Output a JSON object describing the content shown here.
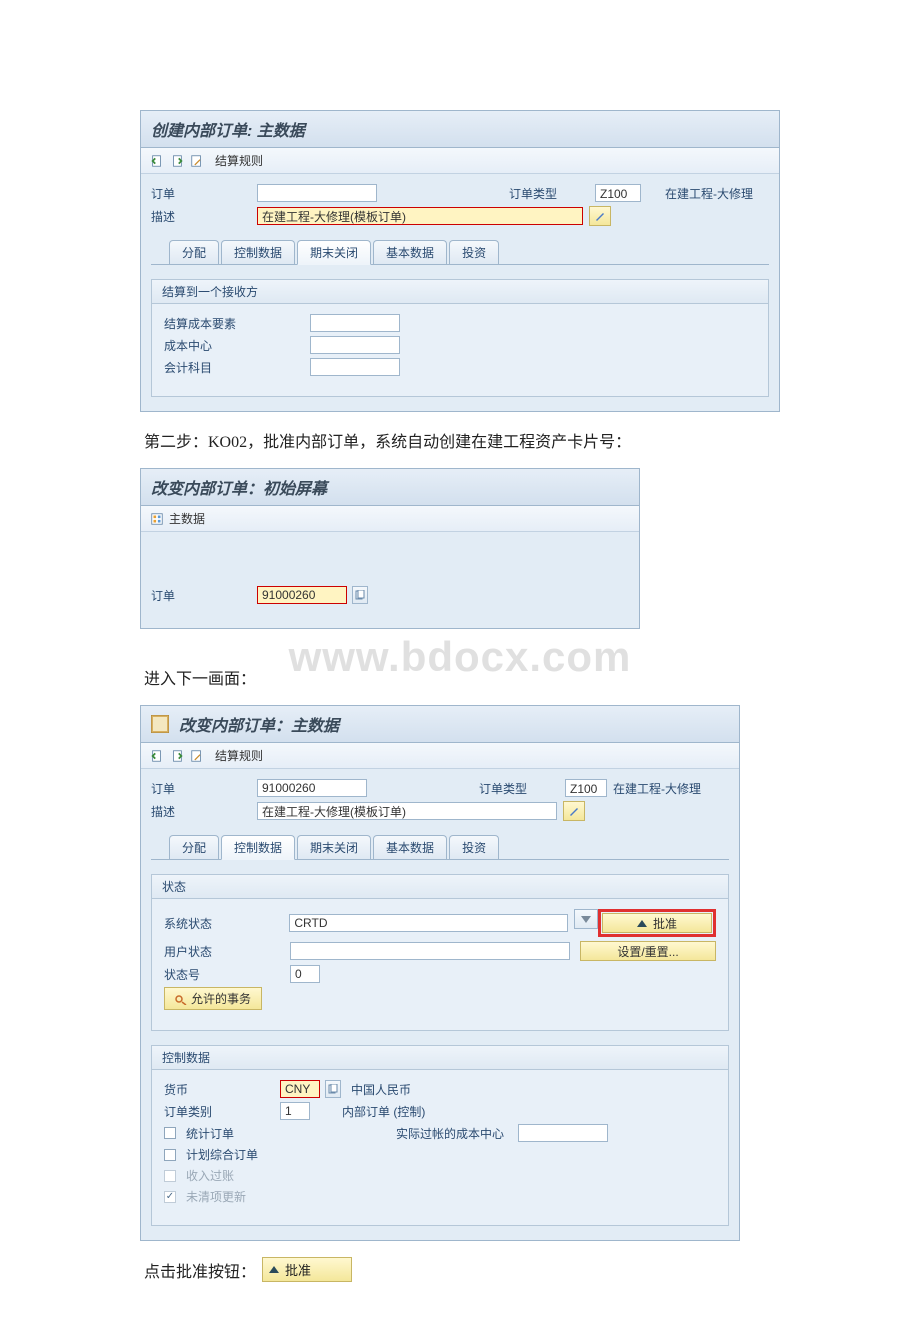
{
  "s1": {
    "title": "创建内部订单: 主数据",
    "toolbar_rule": "结算规则",
    "order_label": "订单",
    "order_value": "",
    "order_type_label": "订单类型",
    "order_type": "Z100",
    "order_type_desc": "在建工程-大修理",
    "desc_label": "描述",
    "desc_value": "在建工程-大修理(模板订单)",
    "tabs": [
      "分配",
      "控制数据",
      "期末关闭",
      "基本数据",
      "投资"
    ],
    "group_title": "结算到一个接收方",
    "settle_ce": "结算成本要素",
    "cost_center": "成本中心",
    "gl_account": "会计科目"
  },
  "step2": "第二步：KO02，批准内部订单，系统自动创建在建工程资产卡片号：",
  "s2": {
    "title": "改变内部订单：初始屏幕",
    "toolbar_master": "主数据",
    "order_label": "订单",
    "order_value": "91000260"
  },
  "next": "进入下一画面：",
  "watermark": "www.bdocx.com",
  "s3": {
    "title": "改变内部订单：主数据",
    "toolbar_rule": "结算规则",
    "order_label": "订单",
    "order_value": "91000260",
    "order_type_label": "订单类型",
    "order_type": "Z100",
    "order_type_desc": "在建工程-大修理",
    "desc_label": "描述",
    "desc_value": "在建工程-大修理(模板订单)",
    "tabs": [
      "分配",
      "控制数据",
      "期末关闭",
      "基本数据",
      "投资"
    ],
    "grp_status": "状态",
    "sys_status_label": "系统状态",
    "sys_status": "CRTD",
    "user_status_label": "用户状态",
    "status_no_label": "状态号",
    "status_no": "0",
    "allow_trans": "允许的事务",
    "approve": "批准",
    "set_reset": "设置/重置...",
    "grp_ctrl": "控制数据",
    "currency_label": "货币",
    "currency": "CNY",
    "currency_desc": "中国人民币",
    "order_cat_label": "订单类别",
    "order_cat": "1",
    "order_cat_desc": "内部订单 (控制)",
    "stat_order": "统计订单",
    "plan_order": "计划综合订单",
    "revenue_post": "收入过账",
    "open_item": "未清项更新",
    "actual_cc": "实际过帐的成本中心"
  },
  "click_approve": "点击批准按钮：",
  "approve_btn": "批准"
}
